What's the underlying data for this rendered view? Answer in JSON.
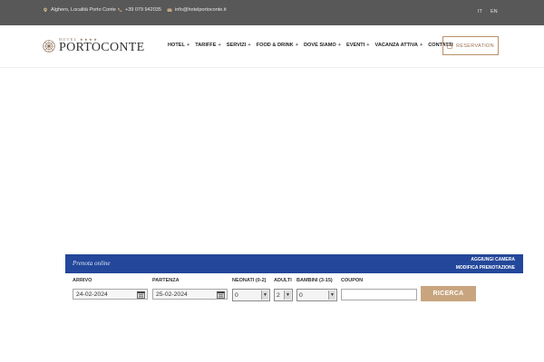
{
  "topbar": {
    "address": "Alghero, Località Porto Conte",
    "phone": "+39 079 942035",
    "email": "info@hotelportoconte.it",
    "lang_it": "IT",
    "lang_en": "EN"
  },
  "logo": {
    "small": "HOTEL ★★★★",
    "big": "PORTOCONTE"
  },
  "nav": {
    "items": [
      {
        "label": "HOTEL",
        "plus": "+"
      },
      {
        "label": "TARIFFE",
        "plus": "+"
      },
      {
        "label": "SERVIZI",
        "plus": "+"
      },
      {
        "label": "FOOD & DRINK",
        "plus": "+"
      },
      {
        "label": "DOVE SIAMO",
        "plus": "+"
      },
      {
        "label": "EVENTI",
        "plus": "+"
      },
      {
        "label": "VACANZA ATTIVA",
        "plus": "+"
      },
      {
        "label": "CONTATTI",
        "plus": ""
      }
    ],
    "reservation": "RESERVATION"
  },
  "booking": {
    "title": "Prenota online",
    "add_room": "AGGIUNGI CAMERA",
    "modify": "MODIFICA PRENOTAZIONE",
    "arrivo_label": "ARRIVO",
    "arrivo_value": "24-02-2024",
    "partenza_label": "PARTENZA",
    "partenza_value": "25-02-2024",
    "neonati_label": "NEONATI (0-2)",
    "neonati_value": "0",
    "adulti_label": "ADULTI",
    "adulti_value": "2",
    "bambini_label": "BAMBINI (3-15)",
    "bambini_value": "0",
    "coupon_label": "COUPON",
    "coupon_value": "",
    "search": "RICERCA"
  },
  "colors": {
    "topbar": "#585858",
    "booking_bar": "#23479a",
    "accent_gold": "#c9a57f"
  },
  "icons": [
    "map-pin-icon",
    "phone-icon",
    "mail-icon",
    "logo-emblem-icon",
    "calendar-icon",
    "chevron-down-icon"
  ]
}
